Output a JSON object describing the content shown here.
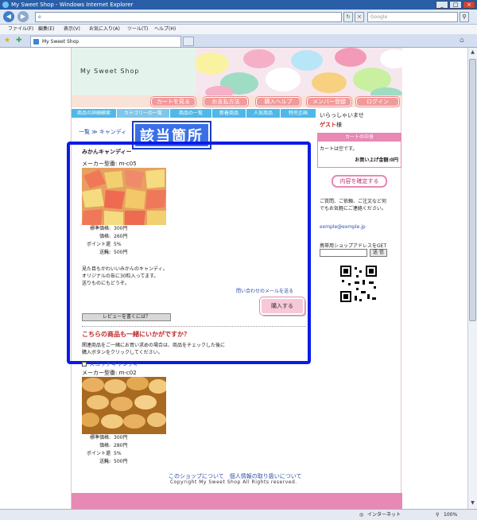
{
  "window": {
    "title": "My Sweet Shop - Windows Internet Explorer",
    "min": "_",
    "max": "□",
    "close": "×"
  },
  "toolbar": {
    "back": "◀",
    "forward": "▶",
    "url_value": "e",
    "search_placeholder": "Google",
    "refresh": "↻",
    "stop": "×",
    "search_go": "⚲"
  },
  "menu": [
    "ファイル(F)",
    "編集(E)",
    "表示(V)",
    "お気に入り(A)",
    "ツール(T)",
    "ヘルプ(H)"
  ],
  "tab": {
    "label": "My Sweet Shop"
  },
  "site": {
    "title": "My Sweet Shop",
    "topnav": [
      "カートを見る",
      "お支払方法",
      "購入ヘルプ",
      "メンバー登録",
      "ログイン"
    ],
    "catnav": [
      "商品の詳細検索",
      "カテゴリーの一覧",
      "商品の一覧",
      "新着商品",
      "人気商品",
      "特売企画"
    ],
    "breadcrumb": "一覧 ≫ キャンディ",
    "annotation": "該当箇所"
  },
  "product": {
    "name": "みかんキャンディー",
    "maker": "メーカー型番: m-c05",
    "prices": [
      {
        "label": "標準価格:",
        "value": "300円"
      },
      {
        "label": "価格:",
        "value": "260円"
      },
      {
        "label": "ポイント還元:",
        "value": "5%"
      },
      {
        "label": "送料:",
        "value": "500円"
      }
    ],
    "desc_lines": [
      "見た目もかわいいみかんのキャンディ。",
      "オリジナルの缶に30粒入ってます。",
      "送りものにもどうぞ。"
    ],
    "contact_link": "問い合わせのメールを送る",
    "buy_label": "購入する",
    "review_label": "レビューを書くには？"
  },
  "recommend": {
    "heading": "こちらの商品も一緒にいかがですか？",
    "desc_lines": [
      "関連商品をご一緒にお買い求めの場合は、商品をチェックした後に",
      "購入ボタンをクリックしてください。"
    ],
    "item": {
      "name": "スコッチキャンディ",
      "maker": "メーカー型番: m-c02",
      "prices": [
        {
          "label": "標準価格:",
          "value": "300円"
        },
        {
          "label": "価格:",
          "value": "280円"
        },
        {
          "label": "ポイント還元:",
          "value": "5%"
        },
        {
          "label": "送料:",
          "value": "500円"
        }
      ]
    }
  },
  "footer": {
    "links": "このショップについて　個人情報の取り扱いについて",
    "copyright": "Copyright My Sweet Shop All Rights reserved."
  },
  "sidebar": {
    "welcome": "いらっしゃいませ",
    "guest_name": "ゲスト",
    "guest_suffix": "様",
    "cart_heading": "カートの中身",
    "cart_empty": "カートは空です。",
    "cart_total": "お買い上げ金額:0円",
    "confirm_label": "内容を確定する",
    "contact_lines": [
      "ご質問、ご依頼、ご注文など何",
      "でもお気軽にご連絡ください。"
    ],
    "email": "exmple@exmple.jp",
    "mobile_label": "携帯用ショップアドレスをGET",
    "send_label": "送 信"
  },
  "status": {
    "zone": "インターネット",
    "zoom": "100%"
  },
  "colors": {
    "highlight": "#0a1be8",
    "pink": "#e888b4",
    "cat_blue": "#4fb8e8"
  }
}
